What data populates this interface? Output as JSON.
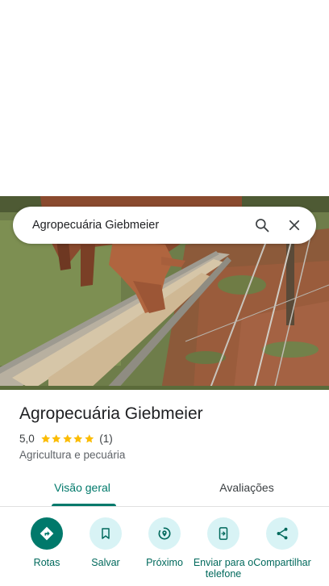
{
  "search": {
    "query": "Agropecuária Giebmeier",
    "search_icon": "search-icon",
    "close_icon": "close-icon"
  },
  "place": {
    "name": "Agropecuária Giebmeier",
    "rating": "5,0",
    "stars_filled": 5,
    "review_count": "(1)",
    "category": "Agricultura e pecuária"
  },
  "tabs": [
    {
      "label": "Visão geral",
      "selected": true
    },
    {
      "label": "Avaliações",
      "selected": false
    }
  ],
  "actions": [
    {
      "label": "Rotas",
      "icon": "directions-icon"
    },
    {
      "label": "Salvar",
      "icon": "bookmark-icon"
    },
    {
      "label": "Próximo",
      "icon": "nearby-icon"
    },
    {
      "label": "Enviar para o telefone",
      "icon": "send-to-phone-icon"
    },
    {
      "label": "Compartilhar",
      "icon": "share-icon"
    }
  ],
  "colors": {
    "accent": "#00796b",
    "action_bg": "#d8f3f5",
    "star": "#fbbc04"
  }
}
